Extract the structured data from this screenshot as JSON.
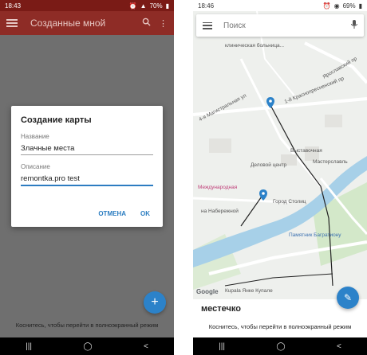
{
  "left": {
    "status": {
      "time": "18:43",
      "battery": "70%"
    },
    "appbar": {
      "title": "Созданные мной"
    },
    "dialog": {
      "title": "Создание карты",
      "name_label": "Название",
      "name_value": "Злачные места",
      "desc_label": "Описание",
      "desc_value": "remontka.pro test",
      "cancel": "ОТМЕНА",
      "ok": "OK"
    },
    "hint": "Коснитесь, чтобы перейти в полноэкранный режим"
  },
  "right": {
    "status": {
      "time": "18:46",
      "battery": "69%"
    },
    "search": {
      "placeholder": "Поиск"
    },
    "map_labels": {
      "hospital": "клиническая больница...",
      "street_top": "Ярославский пр",
      "street_mid": "1-й Краснопресненский пр",
      "magistral": "4-я Магистральная ул",
      "expo": "Выставочная",
      "business": "Деловой центр",
      "masterslavl": "Мастерславль",
      "mezhdunarodnaya": "Международная",
      "city": "Город Столиц",
      "naberezhnaya": "на Набережной",
      "bagration": "Памятник Багратиону",
      "yanka": "Кupala Янке Купале"
    },
    "sheet": {
      "title": "местечко"
    },
    "hint": "Коснитесь, чтобы перейти в полноэкранный режим",
    "google": "Google"
  },
  "colors": {
    "accent": "#2c82c9",
    "appbar": "#8e2c26",
    "river": "#a7d0e8"
  }
}
